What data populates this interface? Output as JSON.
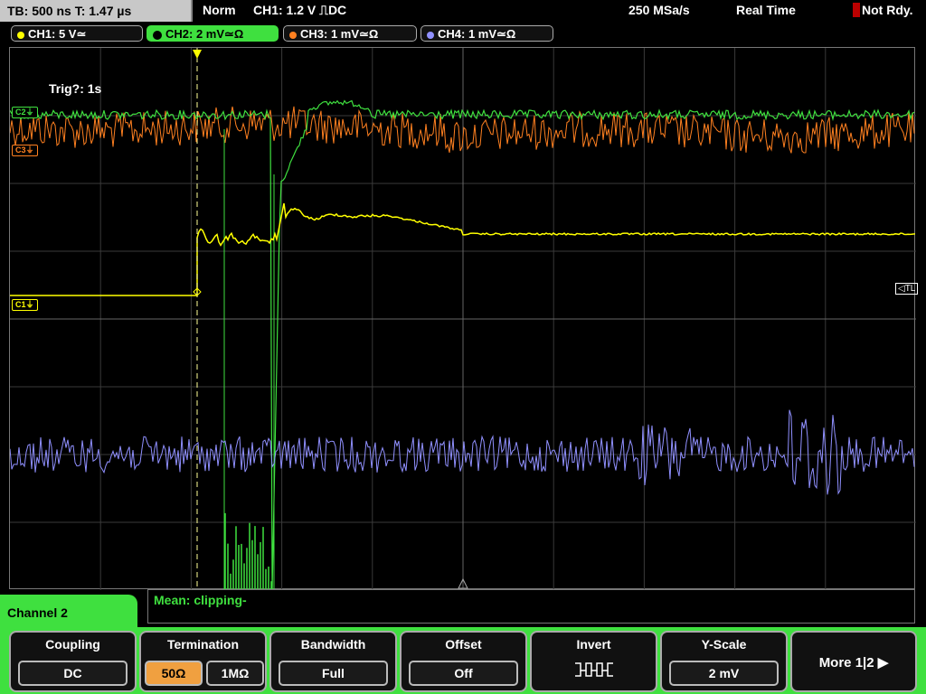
{
  "topbar": {
    "timebase": "TB: 500 ns   T: 1.47 µs",
    "mode": "Norm",
    "trigger": "CH1: 1.2 V ⎍DC",
    "sample_rate": "250 MSa/s",
    "acquisition": "Real Time",
    "status": "Not Rdy."
  },
  "channels": [
    {
      "label": "CH1: 5 V≃",
      "color": "#ffff00"
    },
    {
      "label": "CH2: 2 mV≃Ω",
      "color": "#3fe03f"
    },
    {
      "label": "CH3: 1 mV≃Ω",
      "color": "#ff8020"
    },
    {
      "label": "CH4: 1 mV≃Ω",
      "color": "#9090ff"
    }
  ],
  "screen": {
    "trig_info": "Trig?: 1s",
    "markers": {
      "c1": "C1⏚",
      "c2": "C2⏚",
      "c3": "C3⏚",
      "tl": "◁TL"
    }
  },
  "measurement": {
    "label": "Mean: clipping-"
  },
  "menu": {
    "title": "Channel 2",
    "keys": [
      {
        "title": "Coupling",
        "value": "DC"
      },
      {
        "title": "Termination",
        "options": [
          "50Ω",
          "1MΩ"
        ],
        "selected": "50Ω"
      },
      {
        "title": "Bandwidth",
        "value": "Full"
      },
      {
        "title": "Offset",
        "value": "Off"
      },
      {
        "title": "Invert",
        "icon": "invert-icon"
      },
      {
        "title": "Y-Scale",
        "value": "2 mV"
      }
    ],
    "more": "More 1|2"
  }
}
